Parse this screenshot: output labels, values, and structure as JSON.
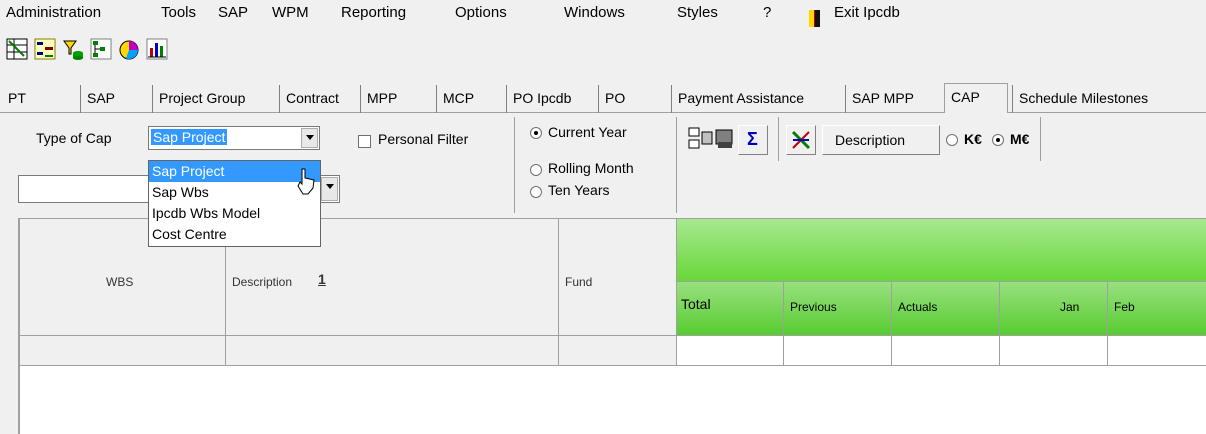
{
  "menu": {
    "items": [
      "Administration",
      "Tools",
      "SAP",
      "WPM",
      "Reporting",
      "Options",
      "Windows",
      "Styles",
      "?"
    ],
    "exit_label": "Exit Ipcdb"
  },
  "toolbar": {
    "icons": [
      "grid-tree-icon",
      "hierarchy-icon",
      "filter-db-icon",
      "tree-edit-icon",
      "pie-chart-icon",
      "bar-chart-icon"
    ]
  },
  "tabs": [
    {
      "label": "PT"
    },
    {
      "label": "SAP"
    },
    {
      "label": "Project Group"
    },
    {
      "label": "Contract"
    },
    {
      "label": "MPP"
    },
    {
      "label": "MCP"
    },
    {
      "label": "PO Ipcdb"
    },
    {
      "label": "PO"
    },
    {
      "label": "Payment Assistance"
    },
    {
      "label": "SAP MPP"
    },
    {
      "label": "CAP",
      "active": true
    },
    {
      "label": "Schedule Milestones"
    }
  ],
  "filters": {
    "type_of_cap_label": "Type of Cap",
    "type_of_cap_value": "Sap Project",
    "type_of_cap_options": [
      "Sap Project",
      "Sap Wbs",
      "Ipcdb Wbs Model",
      "Cost Centre"
    ],
    "second_combo_value": "",
    "personal_filter_label": "Personal Filter",
    "personal_filter_checked": false,
    "period_options": [
      {
        "label": "Current Year",
        "selected": true
      },
      {
        "label": "Rolling Month",
        "selected": false
      },
      {
        "label": "Ten Years",
        "selected": false
      }
    ],
    "description_button": "Description",
    "unit_options": [
      {
        "label": "K€",
        "selected": false
      },
      {
        "label": "M€",
        "selected": true
      }
    ],
    "sigma": "Σ"
  },
  "grid": {
    "headers": {
      "wbs": "WBS",
      "description": "Description",
      "sort_indicator": "1",
      "fund": "Fund",
      "total": "Total",
      "previous": "Previous",
      "actuals": "Actuals",
      "jan": "Jan",
      "feb": "Feb"
    }
  },
  "colors": {
    "selection": "#3399ff",
    "green_header": "#68d838"
  }
}
